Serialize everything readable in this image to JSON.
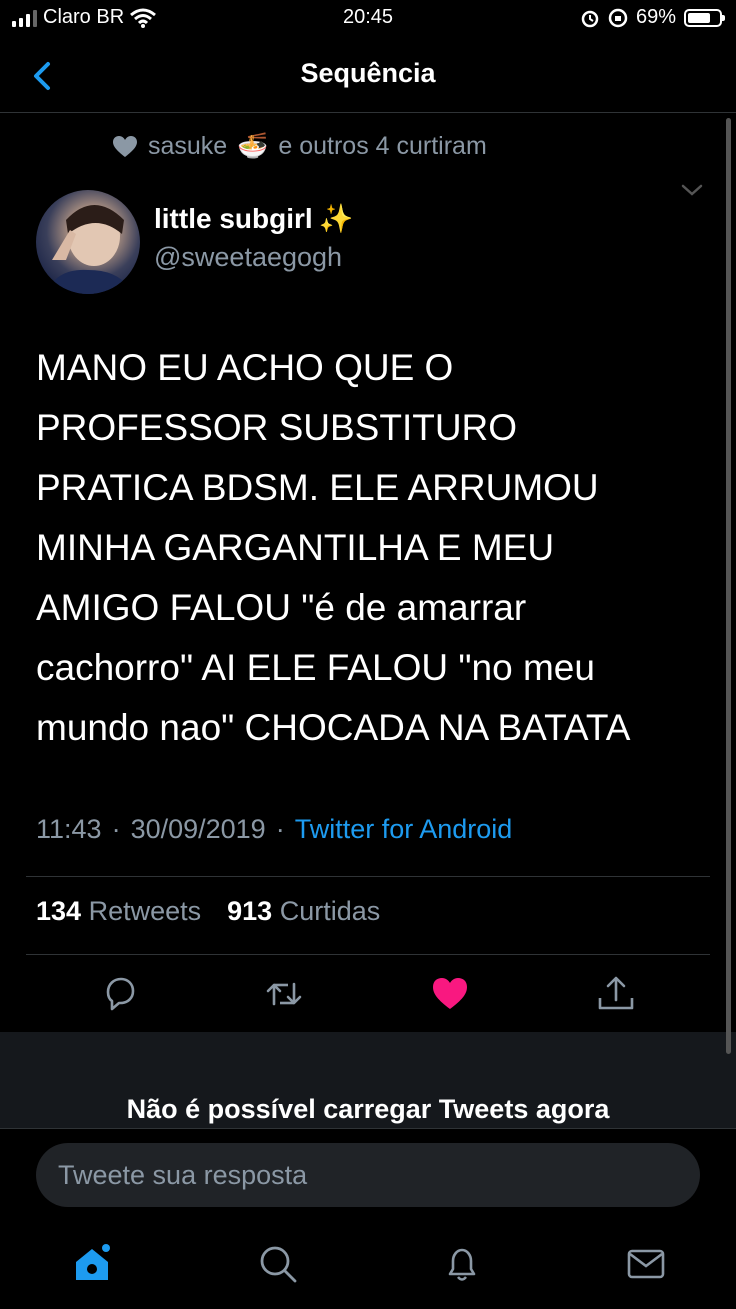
{
  "status_bar": {
    "carrier": "Claro BR",
    "time": "20:45",
    "battery": "69%",
    "battery_level": 0.69
  },
  "header": {
    "title": "Sequência",
    "back_icon": "chevron-left-icon"
  },
  "liked_by": {
    "text_user": "sasuke",
    "emoji": "🍜",
    "text_rest": "e outros 4 curtiram"
  },
  "author": {
    "name": "little subgirl",
    "name_emoji": "✨",
    "handle": "@sweetaegogh"
  },
  "tweet": {
    "text": "MANO EU ACHO QUE O\nPROFESSOR SUBSTITURO\nPRATICA BDSM. ELE ARRUMOU\nMINHA GARGANTILHA E MEU\nAMIGO FALOU \"é de amarrar\ncachorro\" AI ELE FALOU \"no meu\nmundo nao\" CHOCADA NA BATATA",
    "time": "11:43",
    "date": "30/09/2019",
    "separator": "·",
    "source": "Twitter for Android"
  },
  "stats": {
    "retweets_count": "134",
    "retweets_label": "Retweets",
    "likes_count": "913",
    "likes_label": "Curtidas"
  },
  "actions": [
    "reply-icon",
    "retweet-icon",
    "heart-icon",
    "share-icon"
  ],
  "colors": {
    "accent": "#1d9bf0",
    "like": "#f91880",
    "muted": "#8b98a5"
  },
  "error_message": "Não é possível carregar Tweets agora",
  "composer": {
    "placeholder": "Tweete sua resposta"
  },
  "tab_bar": [
    "home-icon",
    "search-icon",
    "notifications-icon",
    "messages-icon"
  ]
}
